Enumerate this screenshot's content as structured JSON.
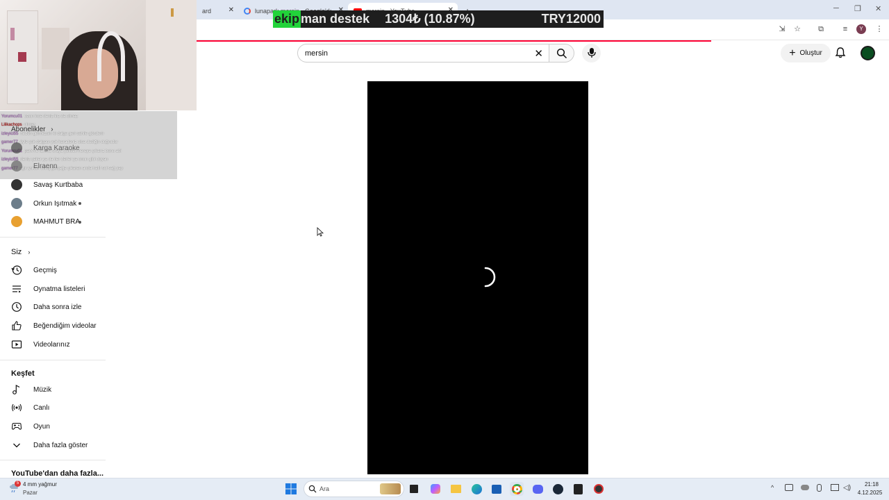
{
  "browser": {
    "tabs": [
      {
        "label": "ard"
      },
      {
        "label": "lunapark mersin - Google'da Ara"
      },
      {
        "label": "mersin - YouTube"
      }
    ]
  },
  "overlay": {
    "banner_lead": "ekip",
    "banner_rest": "man destek",
    "banner_amount": "1304₺ (10.87%)",
    "banner_goal": "TRY12000",
    "banner_progress_percent": 10.87,
    "chat_lines": [
      {
        "user": "Yorumcu01",
        "text": "uzun ince deniz kız da olmaz"
      },
      {
        "user": "Lilikachops",
        "text": "olmaz"
      },
      {
        "user": "izleyici55",
        "text": "neden gelmezsin ki dalga geri sahile gönderir"
      },
      {
        "user": "gamer77",
        "text": "öyle çok dalgası yok karadeniz olsa dediğin doğrudur"
      },
      {
        "user": "Yorumcu01",
        "text": "park ne tarafta oraya yüksek nereye çıkarız bunu abi"
      },
      {
        "user": "izleyici55",
        "text": "deniz çeker ya da iter derler ya onun gibi duyan"
      },
      {
        "user": "gamer77",
        "text": "ağır yukarı bilinç gerçeğe çıkaran anda hafif sol sağ yap"
      }
    ]
  },
  "search": {
    "value": "mersin"
  },
  "header": {
    "create_label": "Oluştur"
  },
  "sidebar": {
    "subscriptions_heading": "Abonelikler",
    "channels": [
      {
        "name": "Karga Karaoke"
      },
      {
        "name": "Elraenn"
      },
      {
        "name": "Savaş Kurtbaba"
      },
      {
        "name": "Orkun Işıtmak"
      },
      {
        "name": "MAHMUT BRA"
      }
    ],
    "you_heading": "Siz",
    "you_items": [
      {
        "label": "Geçmiş",
        "icon": "history-icon"
      },
      {
        "label": "Oynatma listeleri",
        "icon": "playlist-icon"
      },
      {
        "label": "Daha sonra izle",
        "icon": "clock-icon"
      },
      {
        "label": "Beğendiğim videolar",
        "icon": "thumbs-up-icon"
      },
      {
        "label": "Videolarınız",
        "icon": "video-icon"
      }
    ],
    "explore_heading": "Keşfet",
    "explore_items": [
      {
        "label": "Müzik",
        "icon": "music-icon"
      },
      {
        "label": "Canlı",
        "icon": "live-icon"
      },
      {
        "label": "Oyun",
        "icon": "gamepad-icon"
      }
    ],
    "show_more_label": "Daha fazla göster",
    "more_from_youtube": "YouTube'dan daha fazla..."
  },
  "taskbar": {
    "weather_temp": "4 mm yağmur",
    "weather_loc": "Pazar",
    "weather_badge": "5",
    "search_placeholder": "Ara",
    "time": "21:18",
    "date": "4.12.2025"
  },
  "colors": {
    "yt_red": "#ff0033",
    "banner_green": "#22d33a",
    "player_bg": "#000000"
  }
}
